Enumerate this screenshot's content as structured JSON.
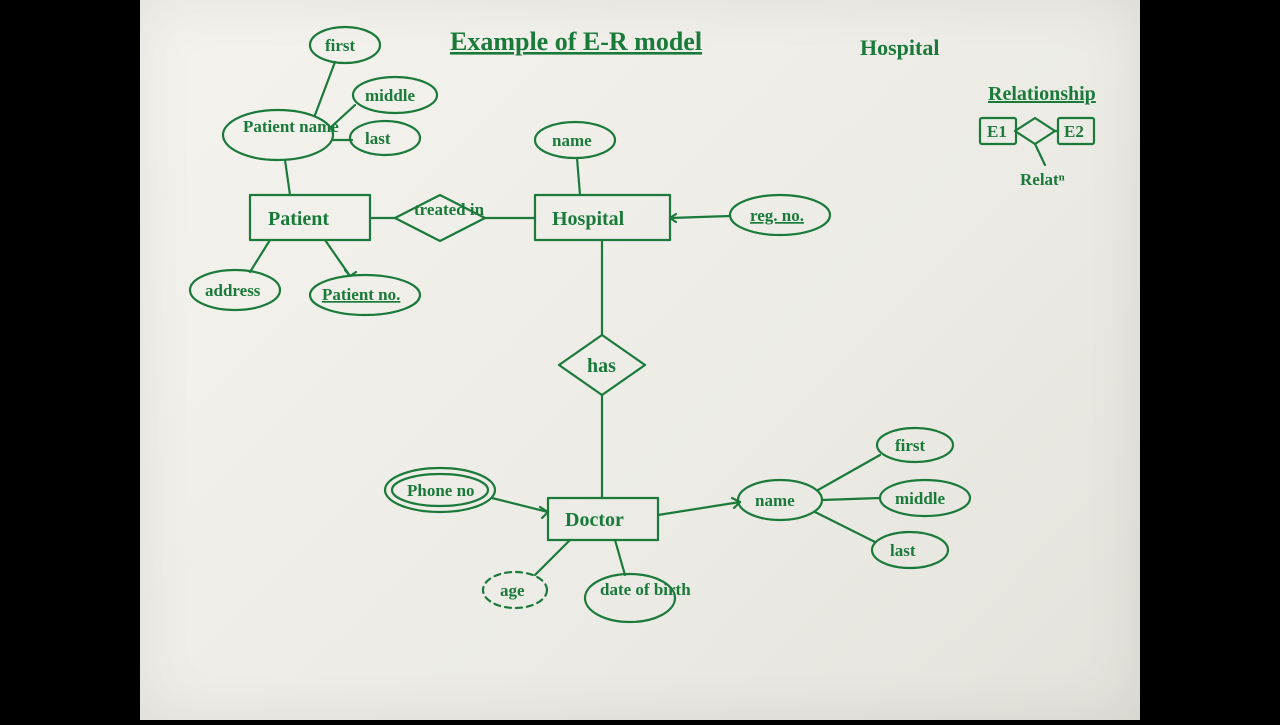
{
  "title": "Example of E-R model",
  "corner_note": "Hospital",
  "legend": {
    "heading": "Relationship",
    "e1": "E1",
    "e2": "E2",
    "relat": "Relatⁿ"
  },
  "entities": {
    "patient": "Patient",
    "hospital": "Hospital",
    "doctor": "Doctor"
  },
  "relationships": {
    "treated_in": "treated in",
    "has": "has"
  },
  "attributes": {
    "patient_name": "Patient name",
    "first": "first",
    "middle": "middle",
    "last": "last",
    "address": "address",
    "patient_no": "Patient no.",
    "hospital_name": "name",
    "reg_no": "reg. no.",
    "phone_no": "Phone no",
    "age": "age",
    "dob": "date of birth",
    "doctor_name": "name",
    "d_first": "first",
    "d_middle": "middle",
    "d_last": "last"
  }
}
